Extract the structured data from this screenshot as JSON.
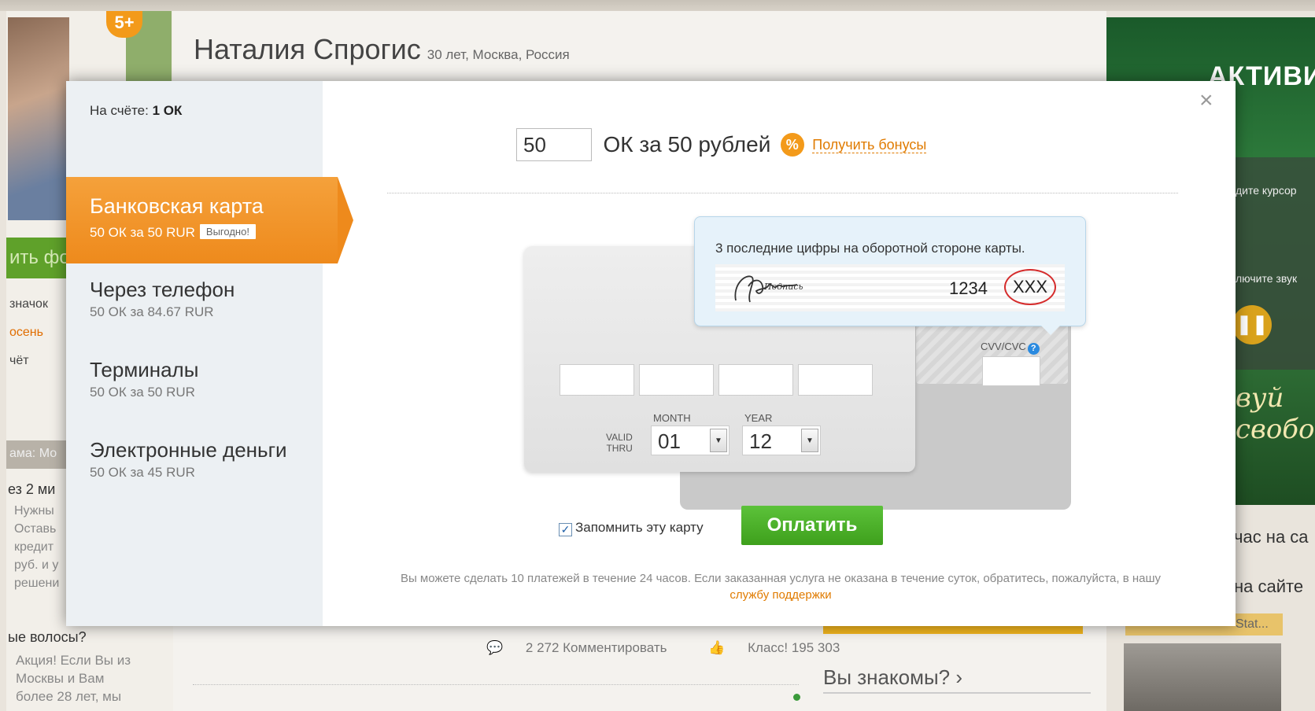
{
  "background": {
    "badge": "5+",
    "profile_name": "Наталия Спрогис",
    "profile_meta": "30 лет, Москва, Россия",
    "left_green_button": "ить фо",
    "left_links": [
      "значок",
      "осень",
      "чёт"
    ],
    "left_ad_title": "ама: Мо",
    "left_text": "ез 2 ми",
    "left_small_lines": [
      "Нужны",
      "Оставь",
      "кредит",
      "руб. и у",
      "решени"
    ],
    "left_question": "ые волосы?",
    "left_bottom_lines": [
      "Акция! Если Вы из",
      "Москвы и Вам",
      "более 28 лет, мы"
    ],
    "ad_logo": "АКТИВИА",
    "ad_text_1": "дите курсор",
    "ad_text_2": "лючите звук",
    "ad_script_1": "вуй",
    "ad_script_2": "свобод",
    "right_text_1": "час на са",
    "right_text_2": "на сайте",
    "right_strip": "Stat...",
    "comments": "2 272 Комментировать",
    "likes": "Класс! 195 303",
    "you_know": "Вы знакомы? ›"
  },
  "modal": {
    "balance_label": "На счёте:",
    "balance_value": "1 ОК",
    "close_label": "×",
    "methods": [
      {
        "title": "Банковская карта",
        "sub": "50 ОК за 50 RUR",
        "tag": "Выгодно!"
      },
      {
        "title": "Через телефон",
        "sub": "50 ОК за 84.67 RUR"
      },
      {
        "title": "Терминалы",
        "sub": "50 ОК за 50 RUR"
      },
      {
        "title": "Электронные деньги",
        "sub": "50 ОК за 45 RUR"
      }
    ],
    "amount_value": "50",
    "amount_label": "ОК за 50 рублей",
    "bonus_link": "Получить бонусы",
    "tooltip": {
      "text": "3 последние цифры на оборотной стороне карты.",
      "signature_word": "Подпись",
      "card_digits": "1234",
      "cvv_placeholder": "XXX"
    },
    "cvv_label": "CVV/CVC",
    "valid_thru_1": "VALID",
    "valid_thru_2": "THRU",
    "month_label": "MONTH",
    "month_value": "01",
    "year_label": "YEAR",
    "year_value": "12",
    "remember_label": "Запомнить эту карту",
    "pay_button": "Оплатить",
    "footer_text": "Вы можете сделать 10 платежей в течение 24 часов. Если заказанная услуга не оказана в течение суток, обратитесь, пожалуйста, в нашу ",
    "footer_link": "службу поддержки"
  }
}
